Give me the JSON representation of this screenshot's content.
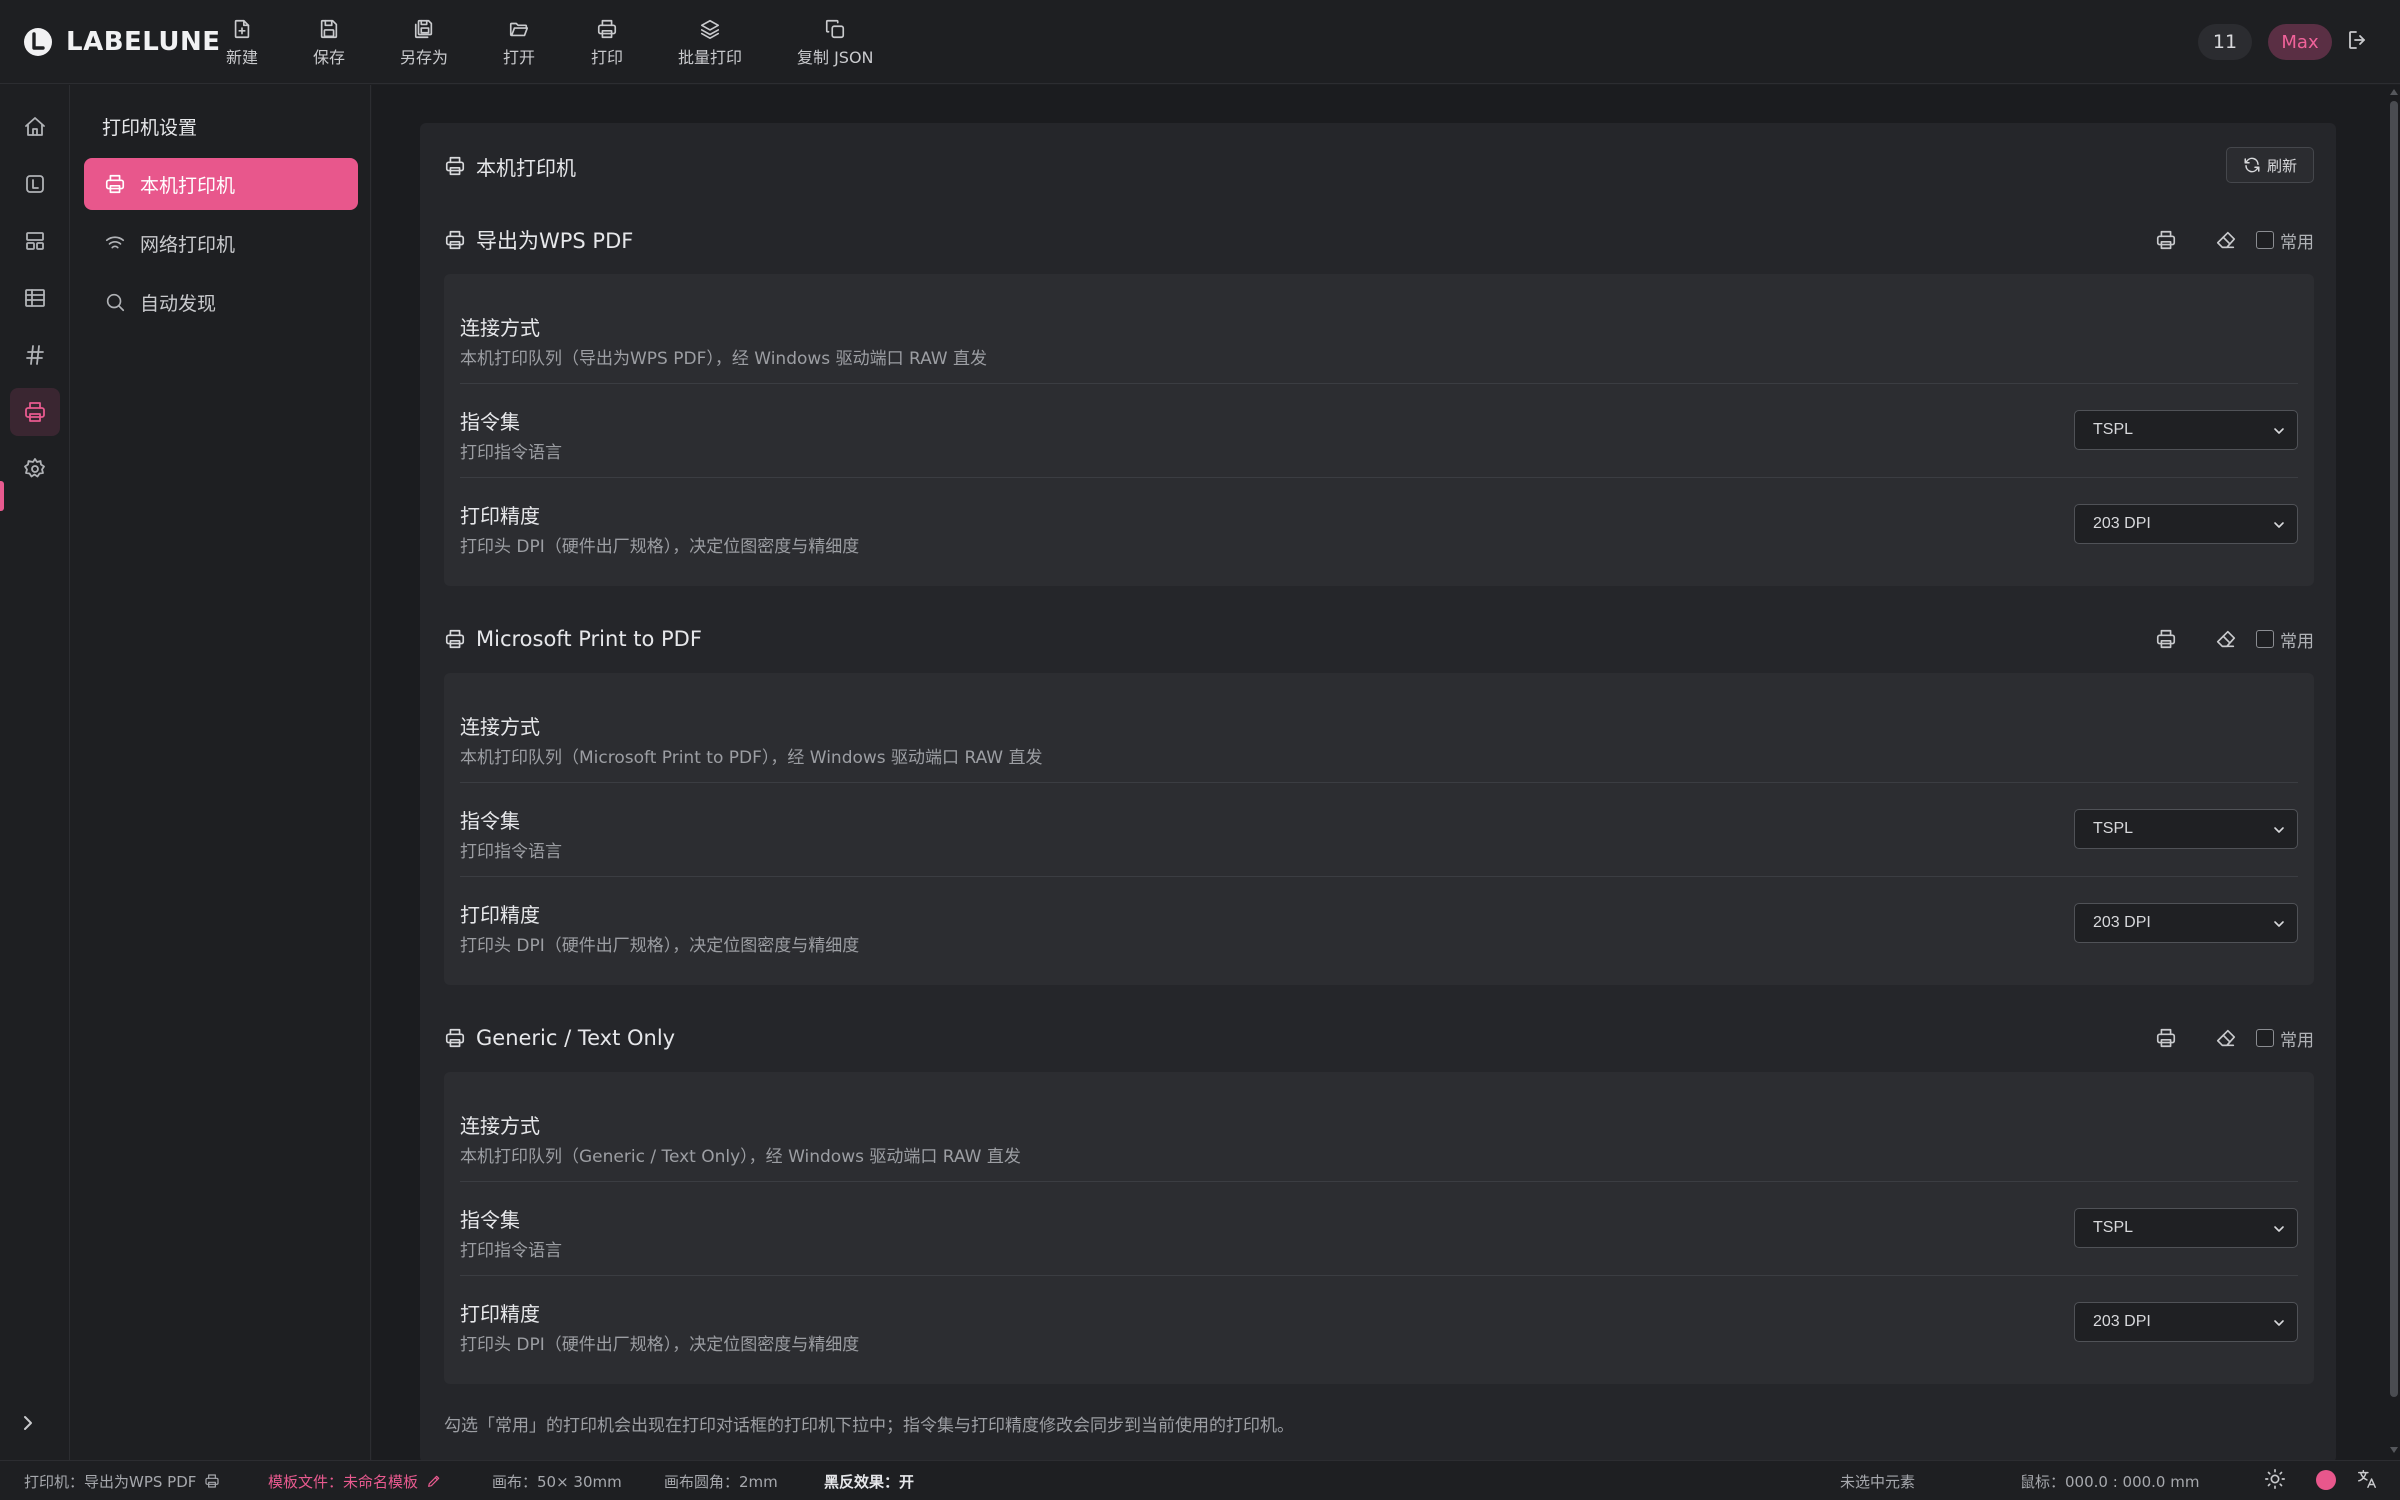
{
  "app": {
    "brand": "LABELUNE"
  },
  "toolbar": {
    "new": "新建",
    "save": "保存",
    "save_as": "另存为",
    "open": "打开",
    "print": "打印",
    "batch_print": "批量打印",
    "copy_json": "复制 JSON"
  },
  "header_right": {
    "count": "11",
    "user": "Max"
  },
  "sidebar": {
    "title": "打印机设置",
    "items": [
      {
        "label": "本机打印机",
        "icon": "printer-icon",
        "active": true
      },
      {
        "label": "网络打印机",
        "icon": "wifi-icon",
        "active": false
      },
      {
        "label": "自动发现",
        "icon": "search-icon",
        "active": false
      }
    ]
  },
  "rail": [
    "home-icon",
    "label-icon",
    "layout-icon",
    "table-icon",
    "hash-icon",
    "printer-icon",
    "settings-icon"
  ],
  "panel": {
    "title": "本机打印机",
    "refresh_label": "刷新",
    "common_label": "常用",
    "row_labels": {
      "connection": "连接方式",
      "command_set": "指令集",
      "command_set_desc": "打印指令语言",
      "dpi": "打印精度",
      "dpi_desc": "打印头 DPI（硬件出厂规格），决定位图密度与精细度"
    },
    "printers": [
      {
        "name": "导出为WPS PDF",
        "connection_desc": "本机打印队列（导出为WPS PDF），经 Windows 驱动端口 RAW 直发",
        "command_set": "TSPL",
        "dpi": "203 DPI",
        "common": false
      },
      {
        "name": "Microsoft Print to PDF",
        "connection_desc": "本机打印队列（Microsoft Print to PDF），经 Windows 驱动端口 RAW 直发",
        "command_set": "TSPL",
        "dpi": "203 DPI",
        "common": false
      },
      {
        "name": "Generic / Text Only",
        "connection_desc": "本机打印队列（Generic / Text Only），经 Windows 驱动端口 RAW 直发",
        "command_set": "TSPL",
        "dpi": "203 DPI",
        "common": false
      }
    ],
    "footnote": "勾选「常用」的打印机会出现在打印对话框的打印机下拉中；指令集与打印精度修改会同步到当前使用的打印机。"
  },
  "statusbar": {
    "printer_label": "打印机：",
    "printer_value": "导出为WPS PDF",
    "template_label": "模板文件：",
    "template_value": "未命名模板",
    "canvas": "画布：50× 30mm",
    "corner": "画布圆角：2mm",
    "invert_label": "黑反效果：",
    "invert_value": "开",
    "selection": "未选中元素",
    "mouse": "鼠标：000.0 : 000.0 mm"
  },
  "colors": {
    "accent": "#e8578c",
    "background": "#1e1f22",
    "panel": "#25262a",
    "card": "#2c2d31"
  }
}
